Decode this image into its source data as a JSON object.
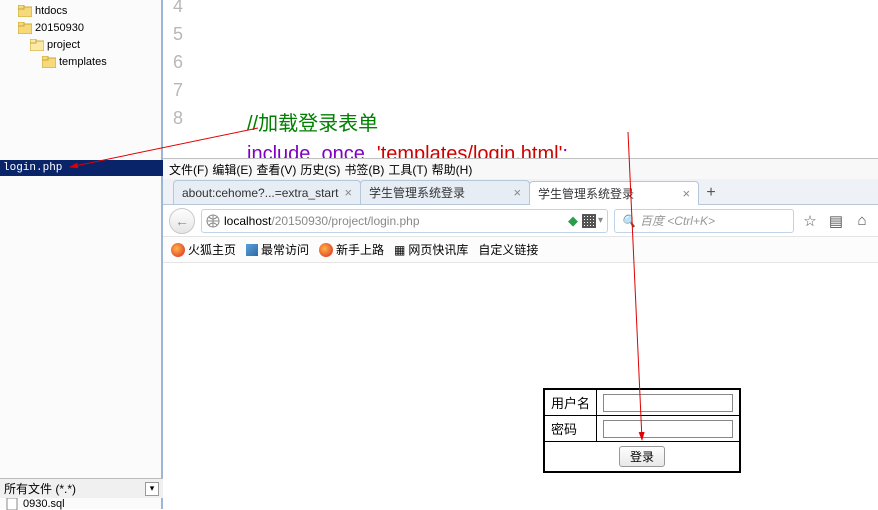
{
  "tree": {
    "items": [
      {
        "label": "htdocs",
        "indent": 0
      },
      {
        "label": "20150930",
        "indent": 1
      },
      {
        "label": "project",
        "indent": 2
      },
      {
        "label": "templates",
        "indent": 3
      }
    ],
    "selected_file": "login.php",
    "filetype_filter": "所有文件 (*.*)",
    "bottom_file": "0930.sql"
  },
  "editor": {
    "lines": {
      "l4": "",
      "l5": "",
      "l6": "",
      "l7_comment": "//加载登录表单",
      "l8_kw": "include_once",
      "l8_str": "'templates/login.html'",
      "l8_semi": ";"
    },
    "gutter": [
      "4",
      "5",
      "6",
      "7",
      "8"
    ]
  },
  "browser": {
    "menu": {
      "file": "文件(F)",
      "edit": "编辑(E)",
      "view": "查看(V)",
      "history": "历史(S)",
      "bookmarks": "书签(B)",
      "tools": "工具(T)",
      "help": "帮助(H)"
    },
    "tabs": [
      {
        "title": "about:cehome?...=extra_start"
      },
      {
        "title": "学生管理系统登录"
      },
      {
        "title": "学生管理系统登录",
        "active": true
      }
    ],
    "url": {
      "host": "localhost",
      "path": "/20150930/project/login.php"
    },
    "search_placeholder": "百度 <Ctrl+K>",
    "bookmarks": {
      "fx": "火狐主页",
      "most": "最常访问",
      "newbie": "新手上路",
      "quick": "网页快讯库",
      "custom": "自定义链接"
    }
  },
  "form": {
    "user_label": "用户名",
    "pass_label": "密码",
    "submit_label": "登录"
  }
}
